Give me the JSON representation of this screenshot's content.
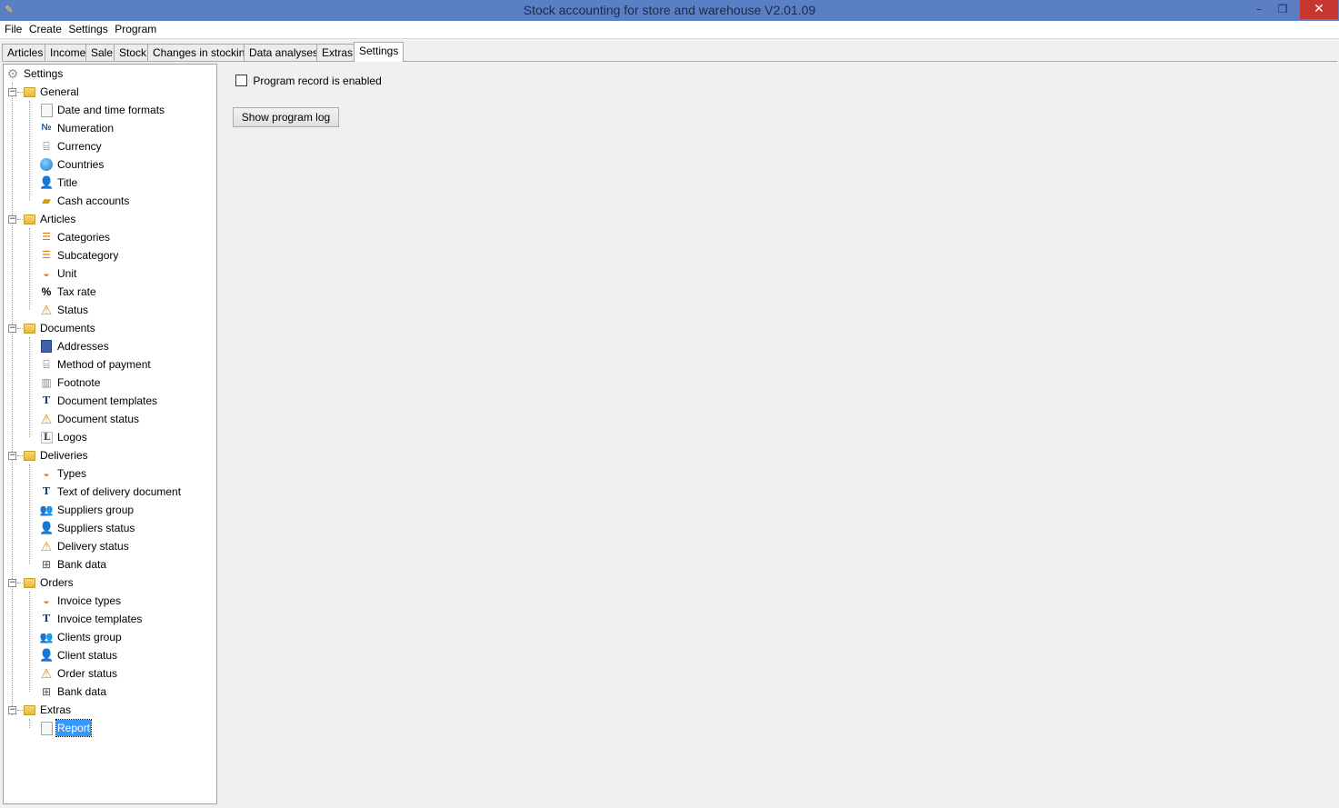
{
  "window": {
    "title": "Stock accounting for store and warehouse V2.01.09",
    "min_glyph": "–",
    "max_glyph": "❐",
    "close_glyph": "✕"
  },
  "menu": [
    "File",
    "Create",
    "Settings",
    "Program"
  ],
  "tabs": [
    {
      "label": "Articles"
    },
    {
      "label": "Income"
    },
    {
      "label": "Sale"
    },
    {
      "label": "Stock"
    },
    {
      "label": "Changes in stocking"
    },
    {
      "label": "Data analyses"
    },
    {
      "label": "Extras"
    },
    {
      "label": "Settings",
      "active": true
    }
  ],
  "tree": {
    "root": "Settings",
    "groups": [
      {
        "label": "General",
        "children": [
          {
            "label": "Date and time formats",
            "icon": "document-icon"
          },
          {
            "label": "Numeration",
            "icon": "numero-icon"
          },
          {
            "label": "Currency",
            "icon": "currency-icon"
          },
          {
            "label": "Countries",
            "icon": "globe-icon"
          },
          {
            "label": "Title",
            "icon": "user-icon"
          },
          {
            "label": "Cash accounts",
            "icon": "cash-icon"
          }
        ]
      },
      {
        "label": "Articles",
        "children": [
          {
            "label": "Categories",
            "icon": "category-icon"
          },
          {
            "label": "Subcategory",
            "icon": "subcategory-icon"
          },
          {
            "label": "Unit",
            "icon": "unit-icon"
          },
          {
            "label": "Tax rate",
            "icon": "percent-icon"
          },
          {
            "label": "Status",
            "icon": "warning-icon"
          }
        ]
      },
      {
        "label": "Documents",
        "children": [
          {
            "label": "Addresses",
            "icon": "address-book-icon"
          },
          {
            "label": "Method of payment",
            "icon": "payment-icon"
          },
          {
            "label": "Footnote",
            "icon": "footnote-icon"
          },
          {
            "label": "Document templates",
            "icon": "template-icon"
          },
          {
            "label": "Document status",
            "icon": "warning-icon"
          },
          {
            "label": "Logos",
            "icon": "logo-icon"
          }
        ]
      },
      {
        "label": "Deliveries",
        "children": [
          {
            "label": "Types",
            "icon": "types-icon"
          },
          {
            "label": "Text of delivery document",
            "icon": "template-icon"
          },
          {
            "label": "Suppliers group",
            "icon": "users-icon"
          },
          {
            "label": "Suppliers status",
            "icon": "user-icon"
          },
          {
            "label": "Delivery status",
            "icon": "warning-icon"
          },
          {
            "label": "Bank data",
            "icon": "bank-icon"
          }
        ]
      },
      {
        "label": "Orders",
        "children": [
          {
            "label": "Invoice types",
            "icon": "types-icon"
          },
          {
            "label": "Invoice templates",
            "icon": "template-icon"
          },
          {
            "label": "Clients group",
            "icon": "users-icon"
          },
          {
            "label": "Client status",
            "icon": "user-icon"
          },
          {
            "label": "Order status",
            "icon": "warning-icon"
          },
          {
            "label": "Bank data",
            "icon": "bank-icon"
          }
        ]
      },
      {
        "label": "Extras",
        "children": [
          {
            "label": "Report",
            "icon": "document-icon",
            "selected": true
          }
        ]
      }
    ]
  },
  "settings_panel": {
    "checkbox_label": "Program record is enabled",
    "checkbox_checked": false,
    "button_label": "Show program log"
  }
}
